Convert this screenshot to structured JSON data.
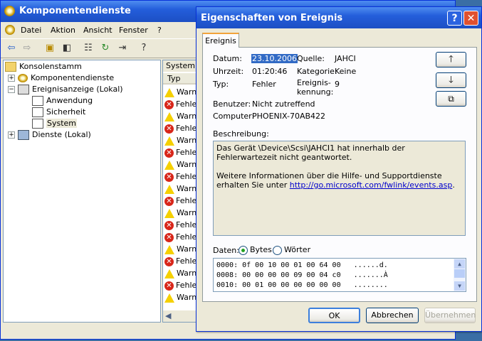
{
  "mmc": {
    "title": "Komponentendienste",
    "menu": [
      "Datei",
      "Aktion",
      "Ansicht",
      "Fenster",
      "?"
    ],
    "tree": [
      {
        "label": "Konsolenstamm",
        "icon": "folder-icon"
      },
      {
        "label": "Komponentendienste",
        "icon": "component-services-icon"
      },
      {
        "label": "Ereignisanzeige (Lokal)",
        "icon": "event-viewer-icon"
      },
      {
        "label": "Anwendung",
        "icon": "log-icon"
      },
      {
        "label": "Sicherheit",
        "icon": "log-icon"
      },
      {
        "label": "System",
        "icon": "log-icon"
      },
      {
        "label": "Dienste (Lokal)",
        "icon": "services-icon"
      }
    ],
    "list_header": "System",
    "list_column": "Typ",
    "list_rows": [
      "Warn",
      "Fehle",
      "Warn",
      "Fehle",
      "Warn",
      "Fehle",
      "Warn",
      "Fehle",
      "Warn",
      "Fehle",
      "Warn",
      "Fehle",
      "Fehle",
      "Warn",
      "Fehle",
      "Warn",
      "Fehle",
      "Warn"
    ]
  },
  "dialog": {
    "title": "Eigenschaften von Ereignis",
    "tab": "Ereignis",
    "fields": {
      "datum_label": "Datum:",
      "datum": "23.10.2006",
      "quelle_label": "Quelle:",
      "quelle": "JAHCI",
      "uhrzeit_label": "Uhrzeit:",
      "uhrzeit": "01:20:46",
      "kategorie_label": "Kategorie:",
      "kategorie": "Keine",
      "typ_label": "Typ:",
      "typ": "Fehler",
      "kennung_label_1": "Ereignis-",
      "kennung_label_2": "kennung:",
      "kennung": "9",
      "benutzer_label": "Benutzer:",
      "benutzer": "Nicht zutreffend",
      "computer_label": "Computer:",
      "computer": "PHOENIX-70AB422"
    },
    "beschreibung_label": "Beschreibung:",
    "beschreibung_1": "Das Gerät \\Device\\Scsi\\JAHCI1 hat innerhalb der Fehlerwartezeit nicht geantwortet.",
    "beschreibung_2": "Weitere Informationen über die Hilfe- und Supportdienste erhalten Sie unter",
    "beschreibung_link": "http://go.microsoft.com/fwlink/events.asp",
    "daten_label": "Daten:",
    "radio_bytes": "Bytes",
    "radio_woerter": "Wörter",
    "hex_rows": [
      "0000: 0f 00 10 00 01 00 64 00   ......d.",
      "0008: 00 00 00 00 09 00 04 c0   .......À",
      "0010: 00 01 00 00 00 00 00 00   ........"
    ],
    "ok": "OK",
    "abbrechen": "Abbrechen",
    "uebernehmen": "Übernehmen"
  }
}
